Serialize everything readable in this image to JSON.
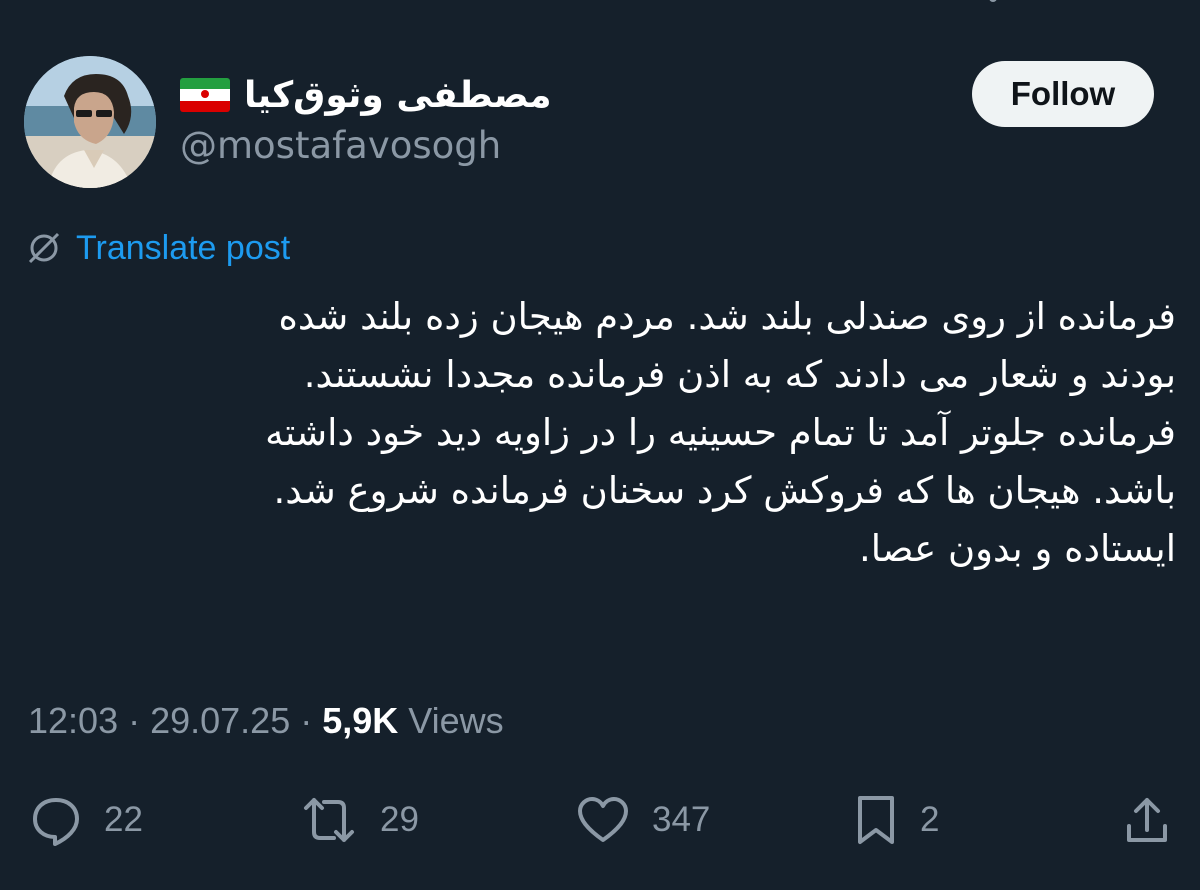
{
  "author": {
    "display_name": "مصطفی وثوق‌کیا",
    "handle": "@mostafavosogh",
    "flag_icon": "iran-flag-icon",
    "avatar_icon": "profile-photo"
  },
  "follow_button": {
    "label": "Follow"
  },
  "translate": {
    "label": "Translate post",
    "icon": "translate-globe-icon"
  },
  "post": {
    "lines": [
      "فرمانده از روی صندلی بلند شد. مردم هیجان زده بلند شده",
      "بودند و شعار می دادند که به اذن فرمانده مجددا نشستند.",
      "فرمانده جلوتر آمد تا تمام حسینیه را در زاویه دید خود داشته",
      "باشد. هیجان ها که فروکش کرد سخنان فرمانده شروع شد.",
      "ایستاده و بدون عصا."
    ]
  },
  "meta": {
    "time": "12:03",
    "separator": " · ",
    "date": "29.07.25",
    "views_count": "5,9K",
    "views_label": " Views"
  },
  "actions": {
    "reply": {
      "icon": "reply-icon",
      "count": "22"
    },
    "repost": {
      "icon": "repost-icon",
      "count": "29"
    },
    "like": {
      "icon": "heart-icon",
      "count": "347"
    },
    "bookmark": {
      "icon": "bookmark-icon",
      "count": "2"
    },
    "share": {
      "icon": "share-icon"
    }
  },
  "colors": {
    "background": "#15202b",
    "text": "#ffffff",
    "secondary": "#8b98a5",
    "link": "#1d9bf0",
    "button_bg": "#eff3f4"
  }
}
